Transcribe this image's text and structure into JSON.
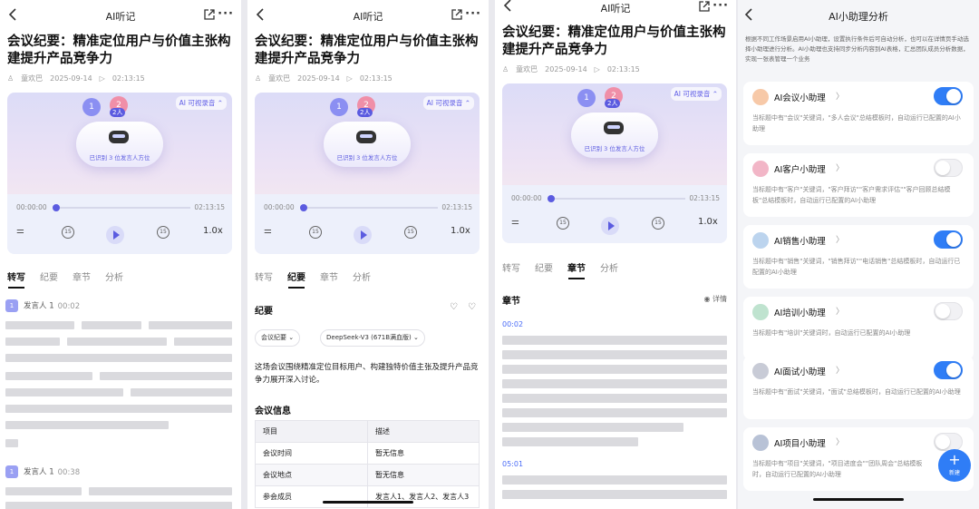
{
  "panel1": {
    "title": "AI听记",
    "doc_title": "会议纪要：精准定位用户与价值主张构建提升产品竞争力",
    "author": "童欢巴",
    "date": "2025-09-14",
    "duration": "02:13:15",
    "ai_tag": "AI 可视录音 ⌃",
    "speaker_count": "2人",
    "device_label": "已识别 3 位发言人方位",
    "time_start": "00:00:00",
    "time_end": "02:13:15",
    "skip_back": "15",
    "skip_fwd": "15",
    "speed": "1.0x",
    "tabs": [
      "转写",
      "纪要",
      "章节",
      "分析"
    ],
    "entries": [
      {
        "speaker": "发言人 1",
        "time": "00:02"
      },
      {
        "speaker": "发言人 1",
        "time": "00:38"
      }
    ]
  },
  "panel2": {
    "title": "AI听记",
    "doc_title": "会议纪要：精准定位用户与价值主张构建提升产品竞争力",
    "author": "童欢巴",
    "date": "2025-09-14",
    "duration": "02:13:15",
    "ai_tag": "AI 可视录音 ⌃",
    "speaker_count": "2人",
    "device_label": "已识别 3 位发言人方位",
    "time_start": "00:00:00",
    "time_end": "02:13:15",
    "skip_back": "15",
    "skip_fwd": "15",
    "speed": "1.0x",
    "tabs": [
      "转写",
      "纪要",
      "章节",
      "分析"
    ],
    "section": "纪要",
    "template_pill": "会议纪要 ⌄",
    "model_pill": "DeepSeek-V3 (671B满血版) ⌄",
    "summary": "这场会议围绕精准定位目标用户、构建独特价值主张及提升产品竞争力展开深入讨论。",
    "info_title": "会议信息",
    "table": {
      "headers": [
        "项目",
        "描述"
      ],
      "rows": [
        [
          "会议时间",
          "暂无信息"
        ],
        [
          "会议地点",
          "暂无信息"
        ],
        [
          "参会成员",
          "发言人1、发言人2、发言人3"
        ]
      ]
    }
  },
  "panel3": {
    "title": "AI听记",
    "doc_title": "会议纪要：精准定位用户与价值主张构建提升产品竞争力",
    "author": "童欢巴",
    "date": "2025-09-14",
    "duration": "02:13:15",
    "ai_tag": "AI 可视录音 ⌃",
    "speaker_count": "2人",
    "device_label": "已识别 3 位发言人方位",
    "time_start": "00:00:00",
    "time_end": "02:13:15",
    "skip_back": "15",
    "skip_fwd": "15",
    "speed": "1.0x",
    "tabs": [
      "转写",
      "纪要",
      "章节",
      "分析"
    ],
    "section": "章节",
    "detail": "详情",
    "chapters": [
      "00:02",
      "05:01"
    ]
  },
  "panel4": {
    "title": "AI小助理分析",
    "description": "根据不同工作场景启用AI小助理，设置执行条件后可自动分析，也可以在详情页手动选择小助理进行分析。AI小助理也支持同步分析内容到AI表格，汇总团队成员分析数据，实现一张表管理一个业务",
    "assistants": [
      {
        "name": "AI会议小助理",
        "desc": "当标题中有\"会议\"关键词，\"多人会议\"总结模板时，自动运行已配置的AI小助理",
        "enabled": true
      },
      {
        "name": "AI客户小助理",
        "desc": "当标题中有\"客户\"关键词，\"客户拜访\"\"客户需求评估\"\"客户回顾总结模板\"总结模板时，自动运行已配置的AI小助理",
        "enabled": false
      },
      {
        "name": "AI销售小助理",
        "desc": "当标题中有\"销售\"关键词，\"销售拜访\"\"电话销售\"总结模板时，自动运行已配置的AI小助理",
        "enabled": true
      },
      {
        "name": "AI培训小助理",
        "desc": "当标题中有\"培训\"关键词时，自动运行已配置的AI小助理",
        "enabled": false
      },
      {
        "name": "AI面试小助理",
        "desc": "当标题中有\"面试\"关键词，\"面试\"总结模板时，自动运行已配置的AI小助理",
        "enabled": true
      },
      {
        "name": "AI项目小助理",
        "desc": "当标题中有\"项目\"关键词，\"项目进度会\"\"团队周会\"总结模板时，自动运行已配置的AI小助理",
        "enabled": false
      }
    ],
    "fab_label": "新建",
    "colors": {
      "accent": "#2f7df6",
      "brand": "#5b5be0"
    }
  }
}
